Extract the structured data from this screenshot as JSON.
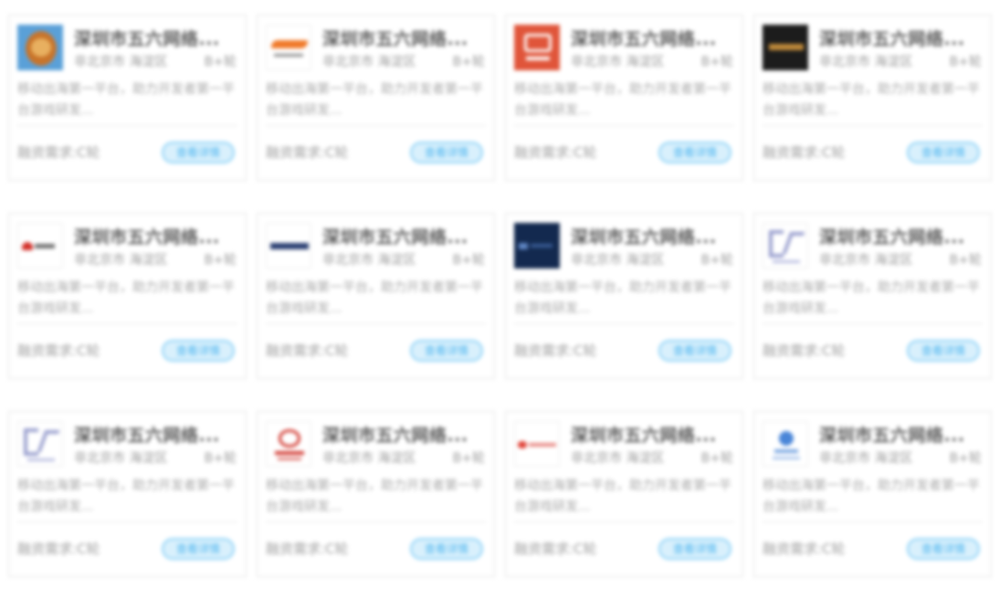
{
  "cards": [
    {
      "company": "深圳市五六网络...",
      "region": "非北京市 海淀区",
      "stage": "B+轮",
      "description": "移动出海第一平台，助力开发者第一平台游戏研发...",
      "finance_label": "融资需求:",
      "finance_value": "C轮",
      "button_label": "查看详情",
      "logo_icon": "game-character-logo-icon"
    },
    {
      "company": "深圳市五六网络...",
      "region": "非北京市 海淀区",
      "stage": "B+轮",
      "description": "移动出海第一平台，助力开发者第一平台游戏研发...",
      "finance_label": "融资需求:",
      "finance_value": "C轮",
      "button_label": "查看详情",
      "logo_icon": "orange-wing-logo-icon"
    },
    {
      "company": "深圳市五六网络...",
      "region": "非北京市 海淀区",
      "stage": "B+轮",
      "description": "移动出海第一平台，助力开发者第一平台游戏研发...",
      "finance_label": "融资需求:",
      "finance_value": "C轮",
      "button_label": "查看详情",
      "logo_icon": "red-square-logo-icon"
    },
    {
      "company": "深圳市五六网络...",
      "region": "非北京市 海淀区",
      "stage": "B+轮",
      "description": "移动出海第一平台，助力开发者第一平台游戏研发...",
      "finance_label": "融资需求:",
      "finance_value": "C轮",
      "button_label": "查看详情",
      "logo_icon": "black-banner-logo-icon"
    },
    {
      "company": "深圳市五六网络...",
      "region": "非北京市 海淀区",
      "stage": "B+轮",
      "description": "移动出海第一平台，助力开发者第一平台游戏研发...",
      "finance_label": "融资需求:",
      "finance_value": "C轮",
      "button_label": "查看详情",
      "logo_icon": "red-hat-logo-icon"
    },
    {
      "company": "深圳市五六网络...",
      "region": "非北京市 海淀区",
      "stage": "B+轮",
      "description": "移动出海第一平台，助力开发者第一平台游戏研发...",
      "finance_label": "融资需求:",
      "finance_value": "C轮",
      "button_label": "查看详情",
      "logo_icon": "navy-wordmark-logo-icon"
    },
    {
      "company": "深圳市五六网络...",
      "region": "非北京市 海淀区",
      "stage": "B+轮",
      "description": "移动出海第一平台，助力开发者第一平台游戏研发...",
      "finance_label": "融资需求:",
      "finance_value": "C轮",
      "button_label": "查看详情",
      "logo_icon": "navy-square-logo-icon"
    },
    {
      "company": "深圳市五六网络...",
      "region": "非北京市 海淀区",
      "stage": "B+轮",
      "description": "移动出海第一平台，助力开发者第一平台游戏研发...",
      "finance_label": "融资需求:",
      "finance_value": "C轮",
      "button_label": "查看详情",
      "logo_icon": "lavender-monogram-logo-icon"
    },
    {
      "company": "深圳市五六网络...",
      "region": "非北京市 海淀区",
      "stage": "B+轮",
      "description": "移动出海第一平台，助力开发者第一平台游戏研发...",
      "finance_label": "融资需求:",
      "finance_value": "C轮",
      "button_label": "查看详情",
      "logo_icon": "lavender-monogram-logo-icon"
    },
    {
      "company": "深圳市五六网络...",
      "region": "非北京市 海淀区",
      "stage": "B+轮",
      "description": "移动出海第一平台，助力开发者第一平台游戏研发...",
      "finance_label": "融资需求:",
      "finance_value": "C轮",
      "button_label": "查看详情",
      "logo_icon": "red-emblem-logo-icon"
    },
    {
      "company": "深圳市五六网络...",
      "region": "非北京市 海淀区",
      "stage": "B+轮",
      "description": "移动出海第一平台，助力开发者第一平台游戏研发...",
      "finance_label": "融资需求:",
      "finance_value": "C轮",
      "button_label": "查看详情",
      "logo_icon": "red-wordmark-logo-icon"
    },
    {
      "company": "深圳市五六网络...",
      "region": "非北京市 海淀区",
      "stage": "B+轮",
      "description": "移动出海第一平台，助力开发者第一平台游戏研发...",
      "finance_label": "融资需求:",
      "finance_value": "C轮",
      "button_label": "查看详情",
      "logo_icon": "blue-globe-logo-icon"
    }
  ]
}
